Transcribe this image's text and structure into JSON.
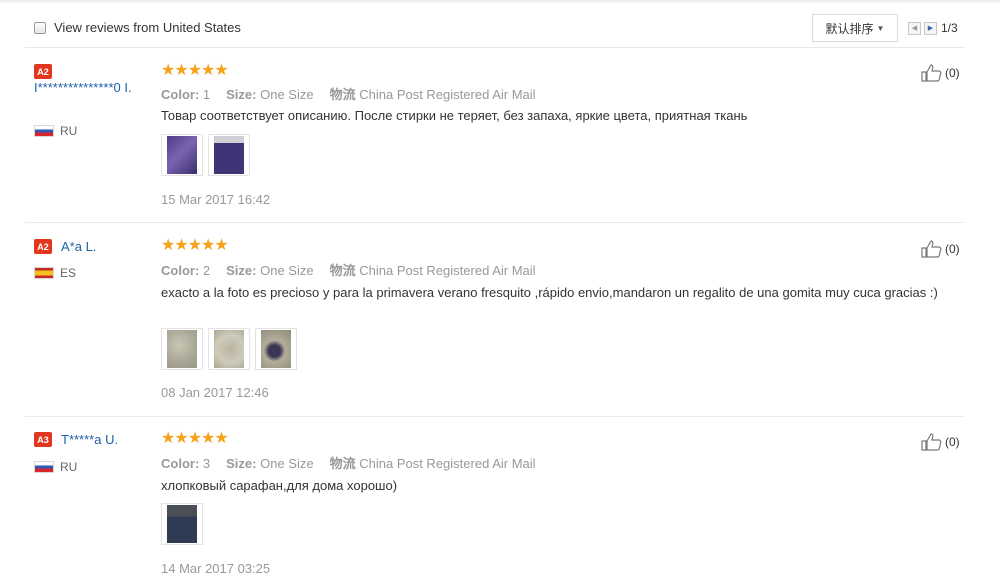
{
  "toolbar": {
    "filter_label": "View reviews from United States",
    "sort_label": "默认排序",
    "page_indicator": "1/3"
  },
  "labels": {
    "color": "Color:",
    "size": "Size:",
    "shipping": "物流"
  },
  "reviews": [
    {
      "badge": "A2",
      "user": "I***************0 I.",
      "country": "RU",
      "rating": 5,
      "stars": "★★★★★",
      "color": "1",
      "size": "One Size",
      "shipping": "China Post Registered Air Mail",
      "text": "Товар соответствует описанию. После стирки не теряет, без запаха, яркие цвета, приятная ткань",
      "photo_count": 2,
      "date": "15 Mar 2017 16:42",
      "helpful": "(0)"
    },
    {
      "badge": "A2",
      "user": "A*a L.",
      "country": "ES",
      "rating": 5,
      "stars": "★★★★★",
      "color": "2",
      "size": "One Size",
      "shipping": "China Post Registered Air Mail",
      "text": "exacto a la foto es precioso y para la primavera verano fresquito ,rápido envio,mandaron un regalito de una gomita muy cuca gracias :)",
      "photo_count": 3,
      "date": "08 Jan 2017 12:46",
      "helpful": "(0)"
    },
    {
      "badge": "A3",
      "user": "T*****a U.",
      "country": "RU",
      "rating": 5,
      "stars": "★★★★★",
      "color": "3",
      "size": "One Size",
      "shipping": "China Post Registered Air Mail",
      "text": "хлопковый сарафан,для дома хорошо)",
      "photo_count": 1,
      "date": "14 Mar 2017 03:25",
      "helpful": "(0)"
    }
  ],
  "colors": {
    "badge": "#e2371f",
    "star": "#f7a019",
    "link": "#1f5ea8",
    "muted": "#999999"
  }
}
